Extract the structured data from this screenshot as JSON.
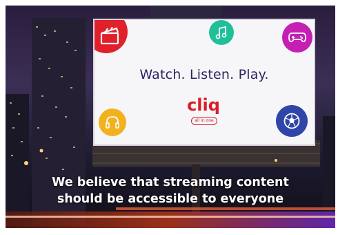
{
  "billboard": {
    "headline": "Watch. Listen. Play.",
    "brand": "cliq",
    "brand_sub": "all in one",
    "icons": [
      "clapperboard-icon",
      "music-note-icon",
      "gamepad-icon",
      "headphones-icon",
      "soccer-ball-icon"
    ]
  },
  "caption": {
    "line1": "We believe that streaming content",
    "line2": "should be accessible to everyone"
  },
  "colors": {
    "brand_red": "#d81e2a",
    "film": "#e0202a",
    "music": "#1fbf9a",
    "game": "#c51fb4",
    "audio": "#f1b21e",
    "ball": "#2f46a8",
    "headline": "#2a2560"
  }
}
